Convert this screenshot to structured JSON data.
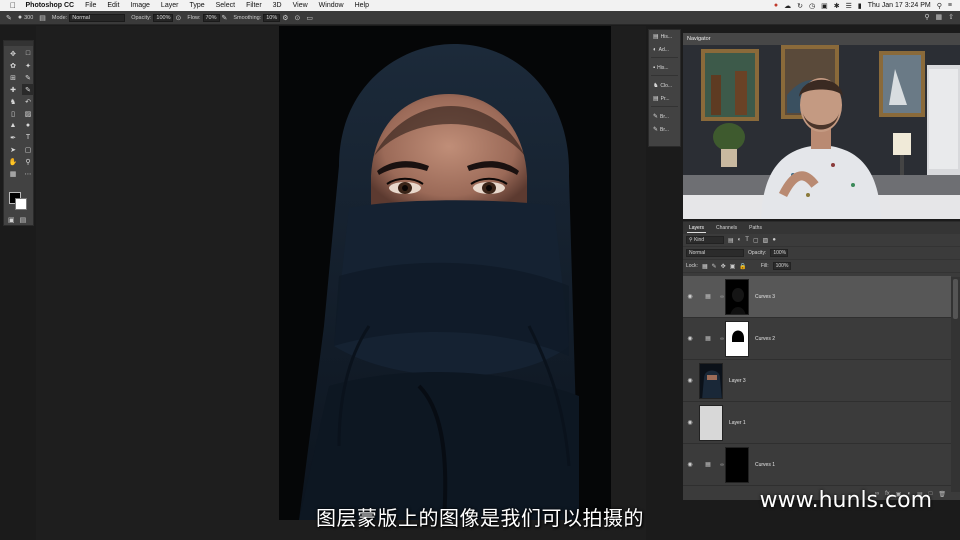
{
  "menubar": {
    "apple_icon": "apple-icon",
    "items": [
      "Photoshop CC",
      "File",
      "Edit",
      "Image",
      "Layer",
      "Type",
      "Select",
      "Filter",
      "3D",
      "View",
      "Window",
      "Help"
    ],
    "clock": "Thu Jan 17  3:24 PM"
  },
  "options": {
    "brush_size": "300",
    "mode_label": "Mode:",
    "mode_value": "Normal",
    "opacity_label": "Opacity:",
    "opacity_value": "100%",
    "flow_label": "Flow:",
    "flow_value": "70%",
    "smoothing_label": "Smoothing:",
    "smoothing_value": "10%"
  },
  "mini_panel": {
    "items": [
      {
        "icon": "histogram-icon",
        "label": "His..."
      },
      {
        "icon": "adjustments-icon",
        "label": "Ad..."
      },
      {
        "icon": "histogram-icon",
        "label": "His..."
      },
      {
        "icon": "clone-source-icon",
        "label": "Clo..."
      },
      {
        "icon": "properties-icon",
        "label": "Pr..."
      },
      {
        "icon": "brush-icon",
        "label": "Br..."
      },
      {
        "icon": "brush-settings-icon",
        "label": "Br..."
      }
    ]
  },
  "navigator": {
    "tab_label": "Navigator"
  },
  "layers_panel": {
    "tabs": [
      "Layers",
      "Channels",
      "Paths"
    ],
    "filter_kind": "Kind",
    "blend_mode": "Normal",
    "opacity_label": "Opacity:",
    "opacity_value": "100%",
    "lock_label": "Lock:",
    "fill_label": "Fill:",
    "fill_value": "100%",
    "layers": [
      {
        "name": "Curves 3",
        "type": "adjustment",
        "selected": true
      },
      {
        "name": "Curves 2",
        "type": "adjustment",
        "selected": false
      },
      {
        "name": "Layer 3",
        "type": "pixel",
        "selected": false
      },
      {
        "name": "Layer 1",
        "type": "pixel",
        "selected": false
      },
      {
        "name": "Curves 1",
        "type": "adjustment",
        "selected": false
      }
    ]
  },
  "subtitle": "图层蒙版上的图像是我们可以拍摄的",
  "watermark": "www.hunls.com"
}
